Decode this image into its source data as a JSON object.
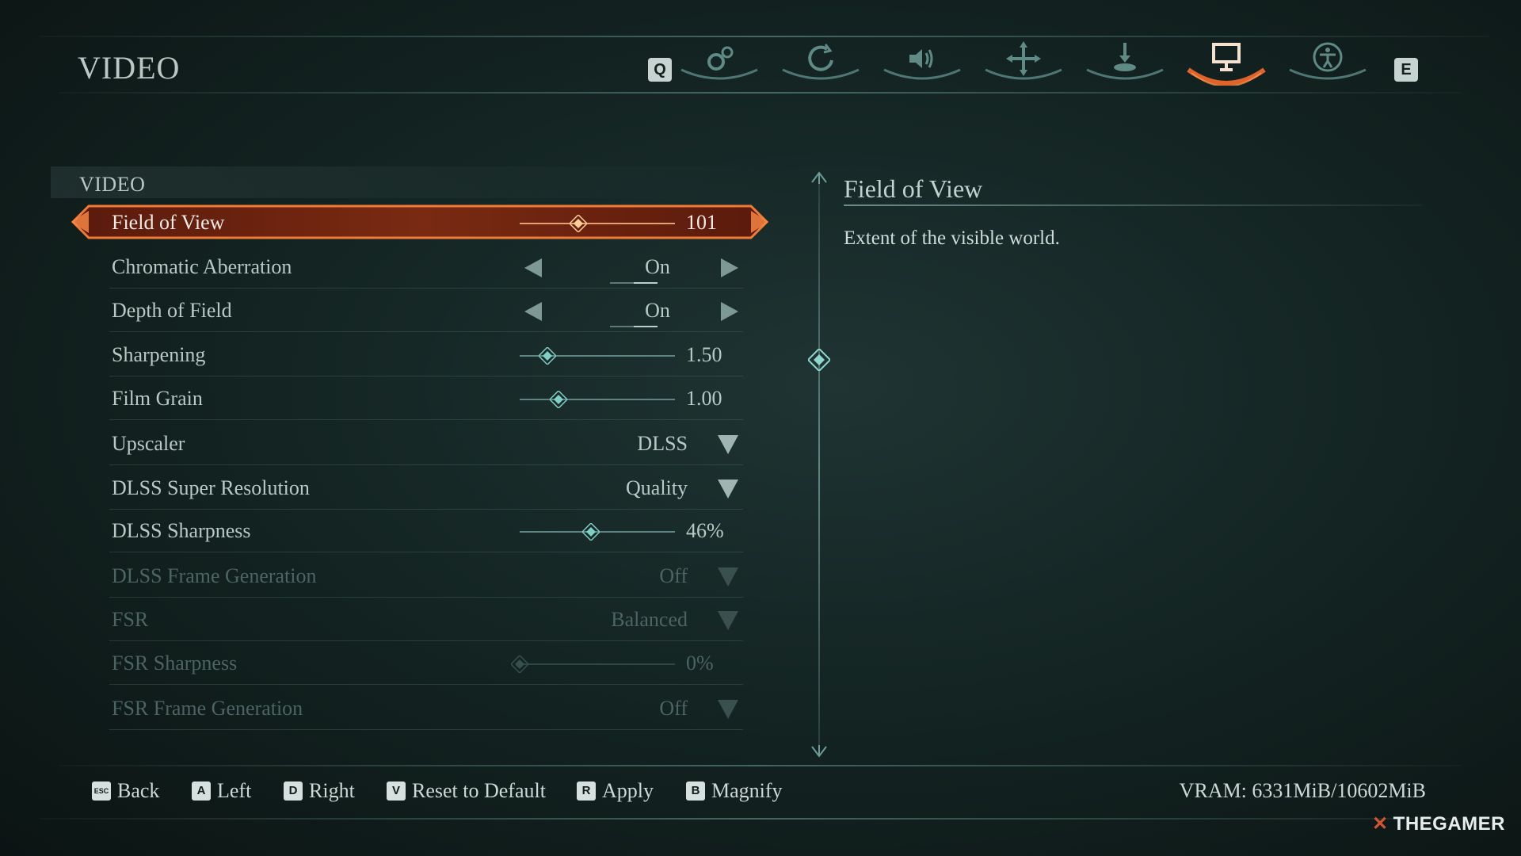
{
  "header": {
    "title": "VIDEO",
    "prev_key": "Q",
    "next_key": "E",
    "tabs": [
      {
        "name": "gameplay",
        "icon": "gears-icon",
        "active": false
      },
      {
        "name": "refresh",
        "icon": "swirl-icon",
        "active": false
      },
      {
        "name": "audio",
        "icon": "speaker-icon",
        "active": false
      },
      {
        "name": "controls",
        "icon": "move-cross-icon",
        "active": false
      },
      {
        "name": "interface",
        "icon": "download-icon",
        "active": false
      },
      {
        "name": "video",
        "icon": "monitor-icon",
        "active": true
      },
      {
        "name": "accessibility",
        "icon": "accessibility-icon",
        "active": false
      }
    ],
    "active_color": "#e0632b"
  },
  "section": {
    "title": "VIDEO"
  },
  "settings": [
    {
      "label": "Field of View",
      "type": "slider",
      "value": "101",
      "fill": 0.38,
      "selected": true
    },
    {
      "label": "Chromatic Aberration",
      "type": "toggle",
      "value": "On"
    },
    {
      "label": "Depth of Field",
      "type": "toggle",
      "value": "On"
    },
    {
      "label": "Sharpening",
      "type": "slider",
      "value": "1.50",
      "fill": 0.18
    },
    {
      "label": "Film Grain",
      "type": "slider",
      "value": "1.00",
      "fill": 0.25
    },
    {
      "label": "Upscaler",
      "type": "dropdown",
      "value": "DLSS"
    },
    {
      "label": "DLSS Super Resolution",
      "type": "dropdown",
      "value": "Quality"
    },
    {
      "label": "DLSS Sharpness",
      "type": "slider",
      "value": "46%",
      "fill": 0.46
    },
    {
      "label": "DLSS Frame Generation",
      "type": "dropdown",
      "value": "Off",
      "disabled": true
    },
    {
      "label": "FSR",
      "type": "dropdown",
      "value": "Balanced",
      "disabled": true
    },
    {
      "label": "FSR Sharpness",
      "type": "slider",
      "value": "0%",
      "fill": 0.0,
      "disabled": true
    },
    {
      "label": "FSR Frame Generation",
      "type": "dropdown",
      "value": "Off",
      "disabled": true
    }
  ],
  "info": {
    "title": "Field of View",
    "description": "Extent of the visible world."
  },
  "footer": {
    "hints": [
      {
        "key": "ESC",
        "label": "Back"
      },
      {
        "key": "A",
        "label": "Left"
      },
      {
        "key": "D",
        "label": "Right"
      },
      {
        "key": "V",
        "label": "Reset to Default"
      },
      {
        "key": "R",
        "label": "Apply"
      },
      {
        "key": "B",
        "label": "Magnify"
      }
    ],
    "vram": "VRAM: 6331MiB/10602MiB"
  },
  "watermark": "THEGAMER"
}
